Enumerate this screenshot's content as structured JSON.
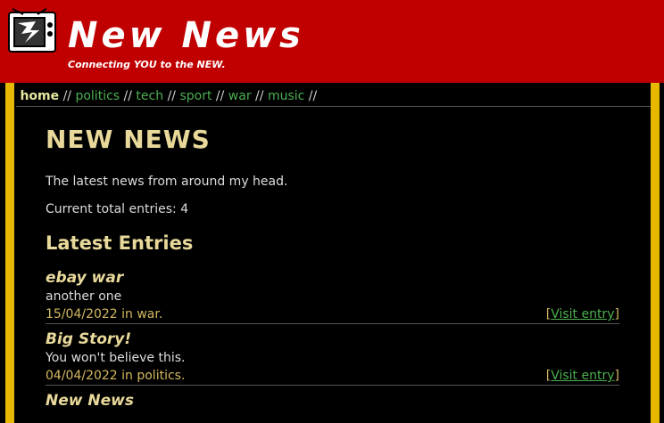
{
  "site": {
    "title": "New News",
    "tagline": "Connecting YOU to the NEW."
  },
  "nav": {
    "items": [
      {
        "label": "home",
        "active": true
      },
      {
        "label": "politics"
      },
      {
        "label": "tech"
      },
      {
        "label": "sport"
      },
      {
        "label": "war"
      },
      {
        "label": "music"
      }
    ],
    "separator": "//"
  },
  "main": {
    "heading": "NEW NEWS",
    "intro": "The latest news from around my head.",
    "total_label": "Current total entries: 4",
    "latest_heading": "Latest Entries",
    "entries": [
      {
        "title": "ebay war",
        "summary": "another one",
        "meta": "15/04/2022 in war.",
        "link": "Visit entry"
      },
      {
        "title": "Big Story!",
        "summary": "You won't believe this.",
        "meta": "04/04/2022 in politics.",
        "link": "Visit entry"
      },
      {
        "title": "New News",
        "summary": "",
        "meta": "",
        "link": ""
      }
    ]
  },
  "colors": {
    "header_bg": "#c00000",
    "page_border": "#e6b800",
    "link": "#4caf50",
    "heading": "#e8d99a"
  },
  "icons": {
    "logo": "retro-tv-icon"
  }
}
